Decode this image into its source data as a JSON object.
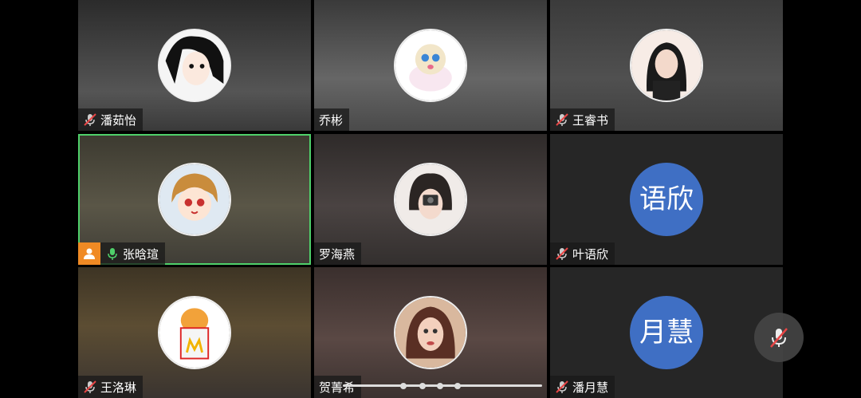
{
  "participants": [
    {
      "name": "潘茹怡",
      "muted": true
    },
    {
      "name": "乔彬",
      "muted": false
    },
    {
      "name": "王睿书",
      "muted": true
    },
    {
      "name": "张晗瑄",
      "muted": false,
      "speaking": true,
      "host": true
    },
    {
      "name": "罗海燕",
      "muted": false
    },
    {
      "name": "叶语欣",
      "muted": true,
      "initials": "语欣"
    },
    {
      "name": "王洛琳",
      "muted": true
    },
    {
      "name": "贺菁希",
      "muted": false
    },
    {
      "name": "潘月慧",
      "muted": true,
      "initials": "月慧"
    }
  ],
  "colors": {
    "active_border": "#4fd06a",
    "host_badge": "#f08a24",
    "letter_avatar": "#3f6fc4"
  },
  "icons": {
    "muted": "mic-off-icon",
    "speaking": "mic-on-icon",
    "host": "person-icon"
  }
}
